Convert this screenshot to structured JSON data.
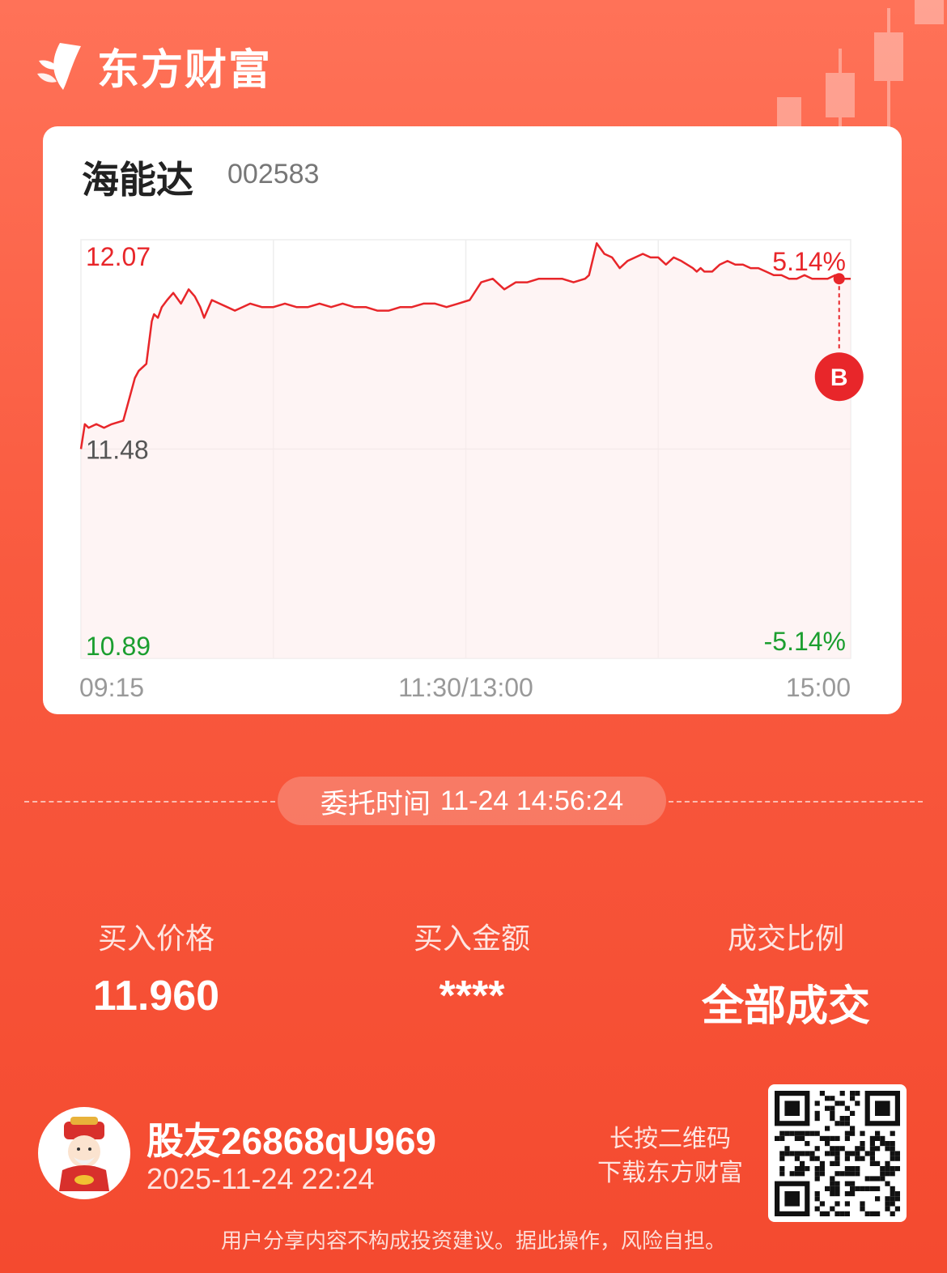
{
  "brand": {
    "name": "东方财富",
    "icon": "eastmoney-logo-icon"
  },
  "stock": {
    "name": "海能达",
    "code": "002583"
  },
  "colors": {
    "up": "#e8262a",
    "down": "#1b9e2f",
    "neutral": "#555555",
    "accent": "#f95a3f"
  },
  "chart_data": {
    "type": "line",
    "title": "",
    "xlabel": "",
    "ylabel": "",
    "ylim": [
      10.89,
      12.07
    ],
    "y_labels": {
      "top": "12.07",
      "mid": "11.48",
      "bottom": "10.89"
    },
    "pct_labels": {
      "top": "5.14%",
      "bottom": "-5.14%"
    },
    "x_tick_labels": [
      "09:15",
      "11:30/13:00",
      "15:00"
    ],
    "grid": true,
    "marker": {
      "label": "B",
      "price": 11.96,
      "time_fraction": 0.985
    },
    "series": [
      {
        "t": [
          0,
          0.005,
          0.01,
          0.02,
          0.03,
          0.04,
          0.055,
          0.06,
          0.07,
          0.075,
          0.085,
          0.092,
          0.095,
          0.1,
          0.105,
          0.112,
          0.12,
          0.13,
          0.14,
          0.148,
          0.155,
          0.16,
          0.17,
          0.18,
          0.19,
          0.2,
          0.21,
          0.22,
          0.235,
          0.25,
          0.265,
          0.28,
          0.295,
          0.31,
          0.325,
          0.34,
          0.355,
          0.37,
          0.385,
          0.4,
          0.415,
          0.43,
          0.445,
          0.46,
          0.475,
          0.49,
          0.505,
          0.52,
          0.535,
          0.55,
          0.565,
          0.58,
          0.595,
          0.61,
          0.625,
          0.64,
          0.655,
          0.66,
          0.67,
          0.68,
          0.69,
          0.7,
          0.71,
          0.72,
          0.73,
          0.74,
          0.75,
          0.76,
          0.77,
          0.78,
          0.795,
          0.8,
          0.805,
          0.81,
          0.82,
          0.83,
          0.84,
          0.85,
          0.86,
          0.87,
          0.88,
          0.89,
          0.9,
          0.91,
          0.92,
          0.93,
          0.94,
          0.95,
          0.96,
          0.97,
          0.98,
          0.99,
          1.0
        ],
        "values": [
          11.48,
          11.55,
          11.54,
          11.55,
          11.54,
          11.55,
          11.56,
          11.6,
          11.68,
          11.7,
          11.72,
          11.84,
          11.86,
          11.85,
          11.88,
          11.9,
          11.92,
          11.89,
          11.93,
          11.91,
          11.88,
          11.85,
          11.9,
          11.89,
          11.88,
          11.87,
          11.88,
          11.89,
          11.88,
          11.88,
          11.89,
          11.88,
          11.88,
          11.89,
          11.88,
          11.89,
          11.88,
          11.88,
          11.87,
          11.87,
          11.88,
          11.88,
          11.89,
          11.89,
          11.88,
          11.89,
          11.9,
          11.95,
          11.96,
          11.93,
          11.95,
          11.95,
          11.96,
          11.96,
          11.96,
          11.95,
          11.96,
          11.97,
          12.06,
          12.03,
          12.02,
          11.99,
          12.01,
          12.02,
          12.03,
          12.02,
          12.02,
          12.0,
          12.02,
          12.01,
          11.99,
          11.98,
          11.99,
          11.98,
          11.98,
          12.0,
          12.01,
          12.0,
          12.0,
          11.99,
          11.99,
          11.98,
          11.97,
          11.97,
          11.96,
          11.96,
          11.97,
          11.96,
          11.96,
          11.96,
          11.97,
          11.96,
          11.96
        ]
      }
    ]
  },
  "order": {
    "time_label": "委托时间",
    "time_value": "11-24 14:56:24"
  },
  "stats": [
    {
      "label": "买入价格",
      "value": "11.960"
    },
    {
      "label": "买入金额",
      "value": "****"
    },
    {
      "label": "成交比例",
      "value": "全部成交"
    }
  ],
  "user": {
    "name": "股友26868qU969",
    "datetime": "2025-11-24 22:24",
    "avatar_icon": "god-of-wealth-avatar-icon"
  },
  "qr": {
    "hint_line1": "长按二维码",
    "hint_line2": "下载东方财富",
    "icon": "qr-code-icon"
  },
  "disclaimer": "用户分享内容不构成投资建议。据此操作，风险自担。"
}
